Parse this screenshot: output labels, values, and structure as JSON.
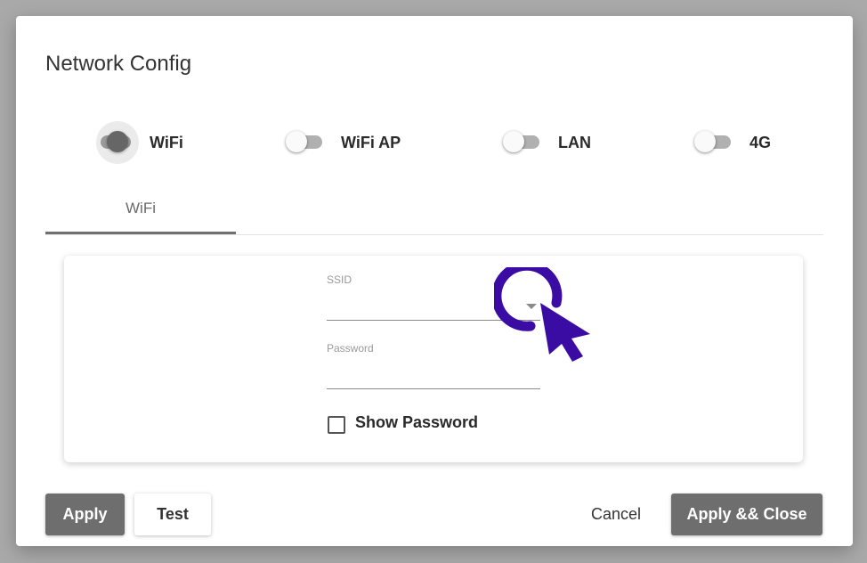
{
  "dialog": {
    "title": "Network Config"
  },
  "toggles": [
    {
      "label": "WiFi",
      "on": true
    },
    {
      "label": "WiFi AP",
      "on": false
    },
    {
      "label": "LAN",
      "on": false
    },
    {
      "label": "4G",
      "on": false
    }
  ],
  "tabs": [
    {
      "label": "WiFi",
      "active": true
    }
  ],
  "form": {
    "ssid": {
      "label": "SSID",
      "value": ""
    },
    "password": {
      "label": "Password",
      "value": ""
    },
    "show_password": {
      "label": "Show Password",
      "checked": false
    }
  },
  "buttons": {
    "apply": "Apply",
    "test": "Test",
    "cancel": "Cancel",
    "apply_close": "Apply && Close"
  },
  "colors": {
    "cursor": "#3a0ca3",
    "primary_button": "#6e6e6e"
  }
}
